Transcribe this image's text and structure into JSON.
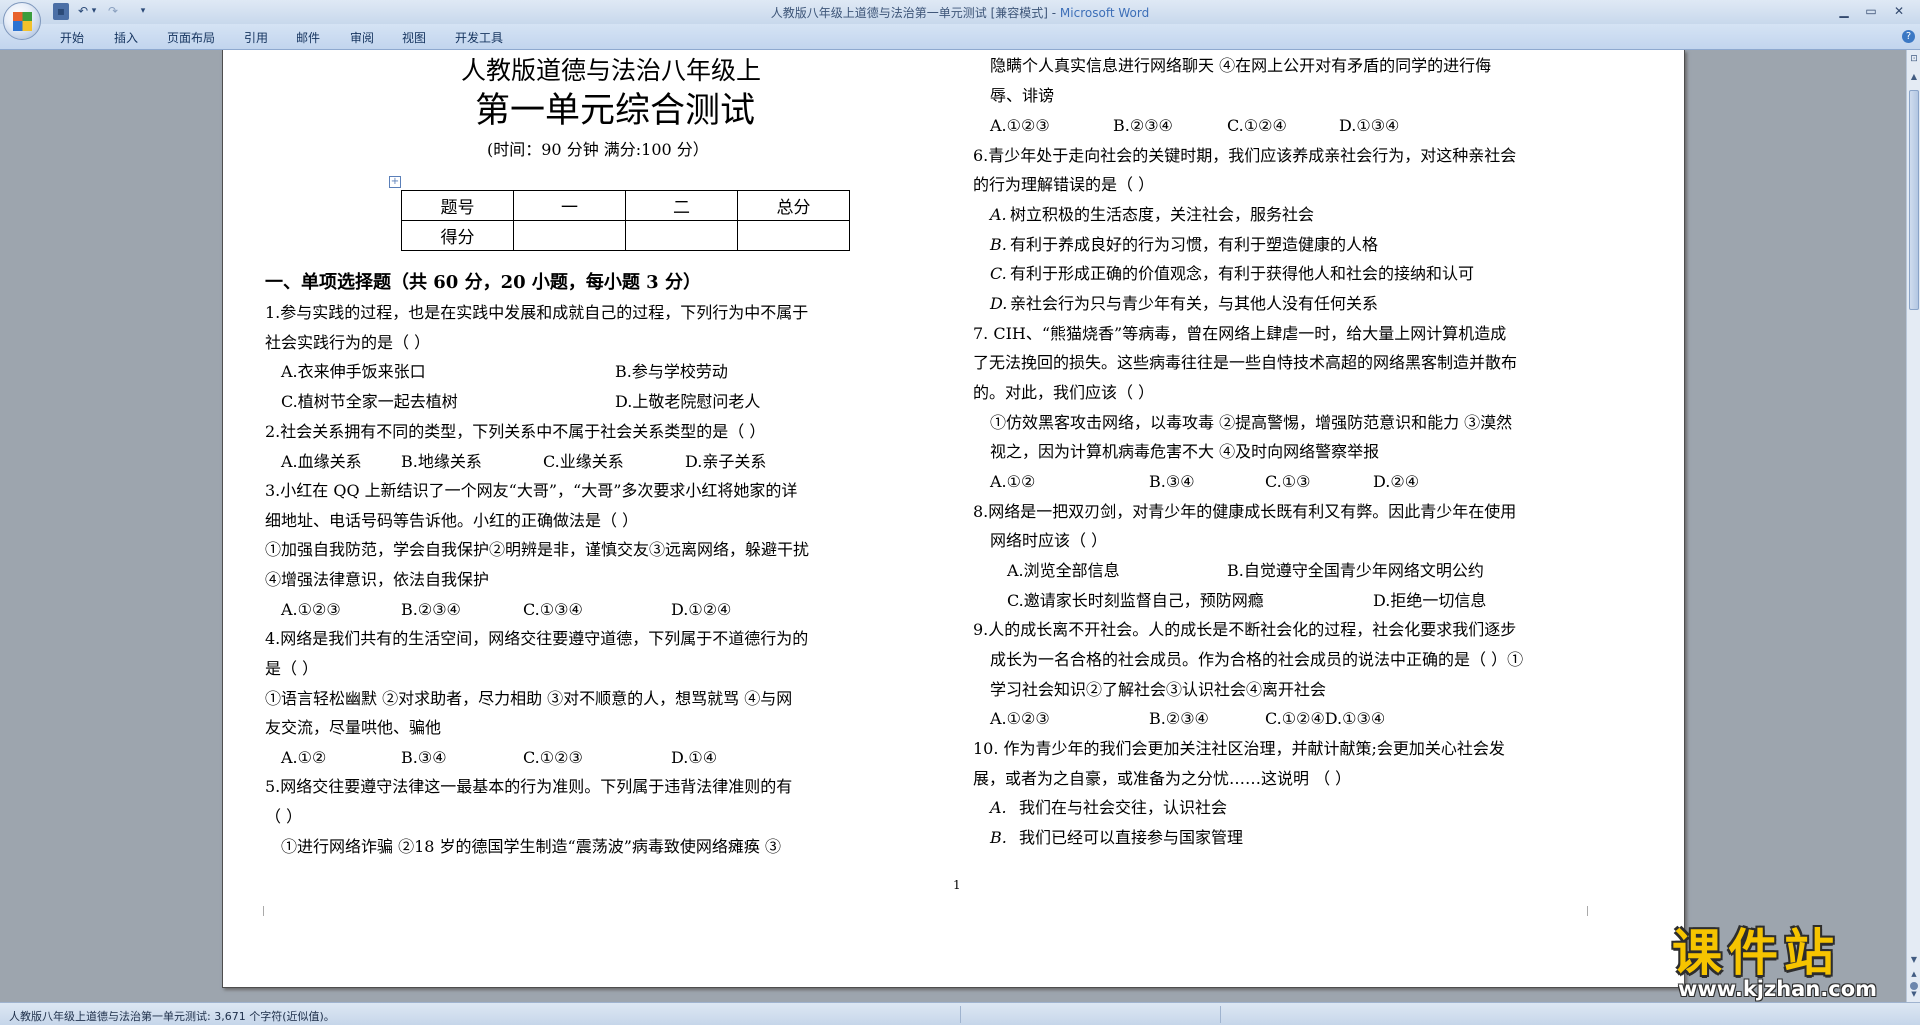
{
  "window": {
    "title": "人教版八年级上道德与法治第一单元测试 [兼容模式] - ",
    "app_name": "Microsoft Word"
  },
  "quick_access": {
    "save_icon": "save-icon",
    "undo_icon": "undo-icon",
    "redo_icon": "redo-icon"
  },
  "ribbon": {
    "tabs": [
      "开始",
      "插入",
      "页面布局",
      "引用",
      "邮件",
      "审阅",
      "视图",
      "开发工具"
    ]
  },
  "document": {
    "title1": "人教版道德与法治八年级上",
    "title2": "第一单元综合测试",
    "time_line": "(时间：90 分钟     满分:100 分）",
    "table": {
      "headers": [
        "题号",
        "一",
        "二",
        "总分"
      ],
      "row_label": "得分"
    },
    "section1": "一、单项选择题（共 60 分，20 小题，每小题 3 分）",
    "left": [
      "1.参与实践的过程，也是在实践中发展和成就自己的过程，下列行为中不属于",
      "社会实践行为的是（    ）",
      "A.衣来伸手饭来张口",
      "B.参与学校劳动",
      "C.植树节全家一起去植树",
      "D.上敬老院慰问老人",
      "2.社会关系拥有不同的类型，下列关系中不属于社会关系类型的是（  ）",
      "A.血缘关系",
      "B.地缘关系",
      "C.业缘关系",
      "D.亲子关系",
      "3.小红在 QQ 上新结识了一个网友“大哥”，“大哥”多次要求小红将她家的详",
      "细地址、电话号码等告诉他。小红的正确做法是（     ）",
      "①加强自我防范，学会自我保护②明辨是非，谨慎交友③远离网络，躲避干扰",
      "④增强法律意识，依法自我保护",
      "A.①②③",
      "B.②③④",
      "C.①③④",
      "D.①②④",
      "4.网络是我们共有的生活空间，网络交往要遵守道德，下列属于不道德行为的",
      "是（      ）",
      "①语言轻松幽默  ②对求助者，尽力相助  ③对不顺意的人，想骂就骂  ④与网",
      "友交流，尽量哄他、骗他",
      "A.①②",
      "B.③④",
      "C.①②③",
      "D.①④",
      "5.网络交往要遵守法律这一最基本的行为准则。下列属于违背法律准则的有",
      "（      ）",
      "①进行网络诈骗  ②18 岁的德国学生制造“震荡波”病毒致使网络瘫痪  ③"
    ],
    "right": [
      "隐瞒个人真实信息进行网络聊天  ④在网上公开对有矛盾的同学的进行侮",
      "辱、诽谤",
      "A.①②③",
      "B.②③④",
      "C.①②④",
      "D.①③④",
      "6.青少年处于走向社会的关键时期，我们应该养成亲社会行为，对这种亲社会",
      "的行为理解错误的是（      ）",
      "A.",
      "树立积极的生活态度，关注社会，服务社会",
      "B.",
      "有利于养成良好的行为习惯，有利于塑造健康的人格",
      "C.",
      "有利于形成正确的价值观念，有利于获得他人和社会的接纳和认可",
      "D.",
      "亲社会行为只与青少年有关，与其他人没有任何关系",
      "7. CIH、“熊猫烧香”等病毒，曾在网络上肆虐一时，给大量上网计算机造成",
      "了无法挽回的损失。这些病毒往往是一些自恃技术高超的网络黑客制造并散布",
      "的。对此，我们应该（      ）",
      "①仿效黑客攻击网络，以毒攻毒 ②提高警惕，增强防范意识和能力 ③漠然",
      "视之，因为计算机病毒危害不大 ④及时向网络警察举报",
      "A.①②",
      "B.③④",
      "C.①③",
      "D.②④",
      "8.网络是一把双刃剑，对青少年的健康成长既有利又有弊。因此青少年在使用",
      "网络时应该（           ）",
      "A.浏览全部信息",
      "B.自觉遵守全国青少年网络文明公约",
      "C.邀请家长时刻监督自己，预防网瘾",
      "D.拒绝一切信息",
      "9.人的成长离不开社会。人的成长是不断社会化的过程，社会化要求我们逐步",
      "成长为一名合格的社会成员。作为合格的社会成员的说法中正确的是（ ）①",
      "学习社会知识②了解社会③认识社会④离开社会",
      "A.①②③",
      "B.②③④",
      "C.①②④D.①③④",
      "10. 作为青少年的我们会更加关注社区治理，并献计献策;会更加关心社会发",
      "展，或者为之自豪，或准备为之分忧……这说明     （    ）",
      "A.",
      "我们在与社会交往，认识社会",
      "B.",
      "我们已经可以直接参与国家管理"
    ],
    "page_number": "1"
  },
  "status": {
    "text": "人教版八年级上道德与法治第一单元测试: 3,671 个字符(近似值)。"
  },
  "watermark": {
    "title": "课件站",
    "url": "www.kjzhan.com"
  }
}
